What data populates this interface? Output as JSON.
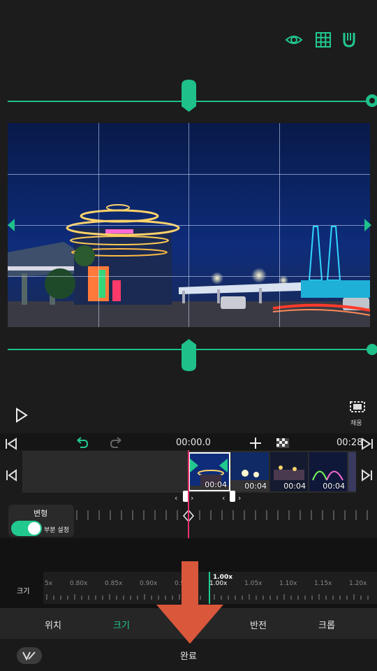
{
  "preview": {
    "fill_label": "채움"
  },
  "toolbar": {
    "timecode": "00:00.0",
    "duration": "00:28"
  },
  "timeline": {
    "clips": [
      {
        "duration": "00:04"
      },
      {
        "duration": "00:04"
      },
      {
        "duration": "00:04"
      },
      {
        "duration": "00:04"
      }
    ]
  },
  "transform": {
    "title": "변형",
    "toggle_label": "부분 설정",
    "toggle_on": true
  },
  "scale": {
    "label": "크기",
    "current": "1.00x",
    "ticks": [
      "5x",
      "0.80x",
      "0.85x",
      "0.90x",
      "0.9",
      "1.00x",
      "1.05x",
      "1.10x",
      "1.15x",
      "1.20x"
    ]
  },
  "tabs": [
    {
      "label": "위치"
    },
    {
      "label": "크기"
    },
    {
      "label": "반전"
    },
    {
      "label": "크롭"
    }
  ],
  "bottom": {
    "done_label": "완료"
  },
  "colors": {
    "accent": "#22c98f",
    "playhead": "#e8336b",
    "overlay_arrow": "#d9573a"
  }
}
